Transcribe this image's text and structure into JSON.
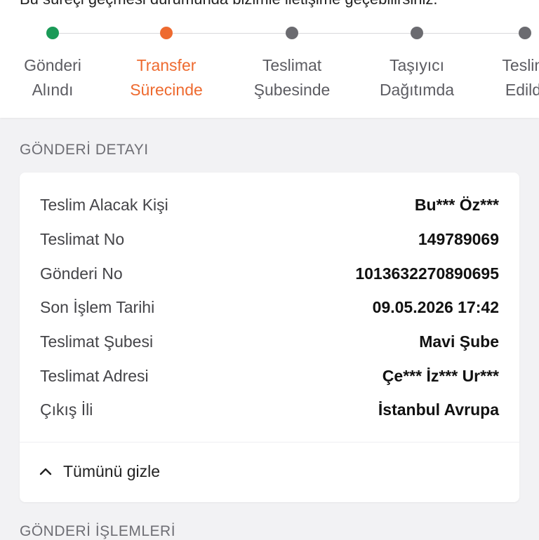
{
  "top_note": "Bu süreçi geçmesi durumunda bizimle iletişime geçebilirsiniz.",
  "steps": [
    {
      "label_line1": "Gönderi",
      "label_line2": "Alındı",
      "status": "completed",
      "color": "#1a9a57"
    },
    {
      "label_line1": "Transfer",
      "label_line2": "Sürecinde",
      "status": "active",
      "color": "#ee6a2f"
    },
    {
      "label_line1": "Teslimat",
      "label_line2": "Şubesinde",
      "status": "pending",
      "color": "#6b6b70"
    },
    {
      "label_line1": "Taşıyıcı",
      "label_line2": "Dağıtımda",
      "status": "pending",
      "color": "#6b6b70"
    },
    {
      "label_line1": "Teslim",
      "label_line2": "Edildi",
      "status": "pending",
      "color": "#6b6b70"
    }
  ],
  "detail_section": {
    "title": "GÖNDERİ DETAYI",
    "rows": [
      {
        "label": "Teslim Alacak Kişi",
        "value": "Bu*** Öz***"
      },
      {
        "label": "Teslimat No",
        "value": "149789069"
      },
      {
        "label": "Gönderi No",
        "value": "1013632270890695"
      },
      {
        "label": "Son İşlem Tarihi",
        "value": "09.05.2026 17:42"
      },
      {
        "label": "Teslimat Şubesi",
        "value": "Mavi Şube"
      },
      {
        "label": "Teslimat Adresi",
        "value": "Çe*** İz*** Ur***"
      },
      {
        "label": "Çıkış İli",
        "value": "İstanbul Avrupa"
      }
    ],
    "toggle_label": "Tümünü gizle",
    "toggle_icon": "chevron-up-icon"
  },
  "operations_section": {
    "title": "GÖNDERİ İŞLEMLERİ"
  }
}
